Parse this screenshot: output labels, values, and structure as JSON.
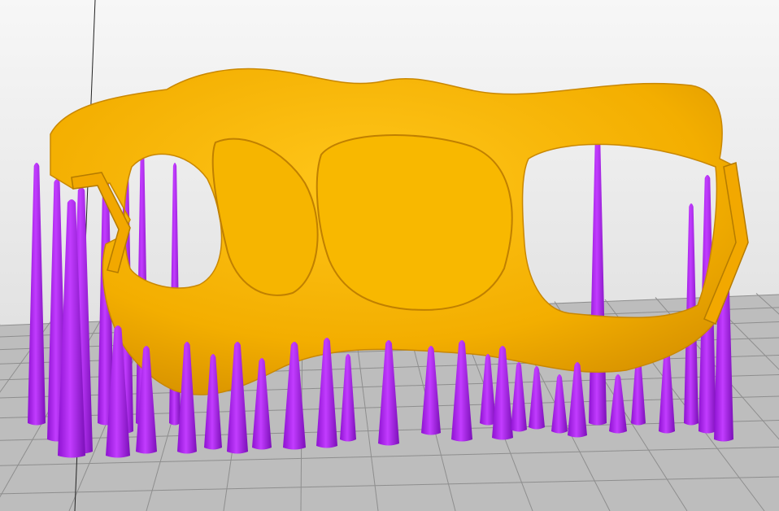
{
  "viewport": {
    "colors": {
      "background_top": "#f7f7f7",
      "background_bottom": "#d9d9d9",
      "bed": "#bdbdbd",
      "bed_grid": "#8e8e8e",
      "model": "#f6b300",
      "model_shadow": "#d48f00",
      "support": "#a41cf0",
      "support_dark": "#7b10b8"
    }
  }
}
